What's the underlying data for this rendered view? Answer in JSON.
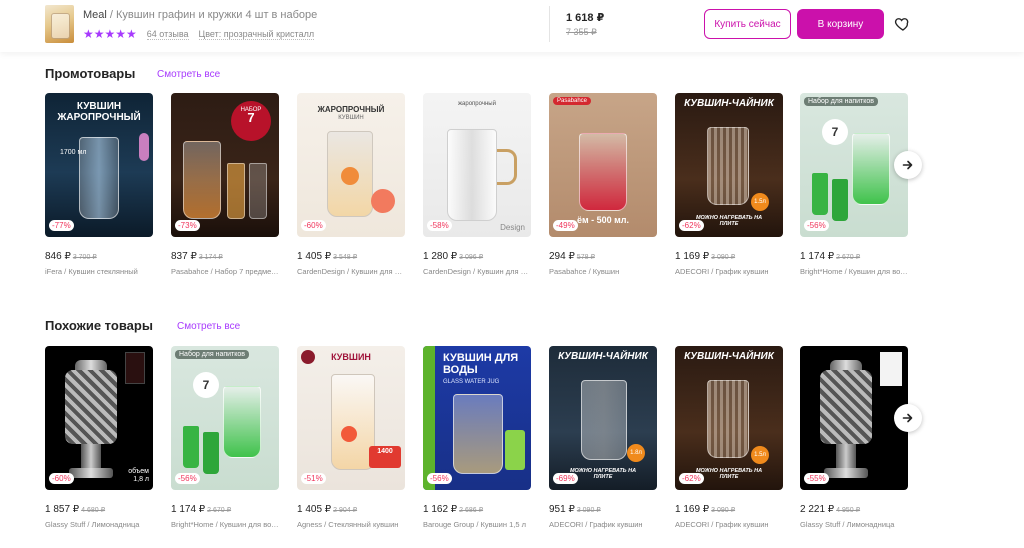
{
  "header": {
    "brand": "Meal",
    "separator": " / ",
    "product_title": "Кувшин графин и кружки 4 шт в наборе",
    "stars": "★★★★★",
    "reviews": "64 отзыва",
    "color": "Цвет: прозрачный кристалл",
    "price_now": "1 618 ₽",
    "price_old": "7 355 ₽",
    "buy_now_label": "Купить сейчас",
    "add_to_cart_label": "В корзину",
    "accent_color": "#cb11ab"
  },
  "promo": {
    "title": "Промотовары",
    "see_all": "Смотреть все",
    "items": [
      {
        "badge": "-77%",
        "price": "846 ₽",
        "old": "3 700 ₽",
        "desc": "iFera / Кувшин стеклянный",
        "img_text": "КУВШИН ЖАРОПРОЧНЫЙ",
        "img_sub": "1700 мл"
      },
      {
        "badge": "-73%",
        "price": "837 ₽",
        "old": "3 174 ₽",
        "desc": "Pasabahce / Набор 7 предметов",
        "img_text": "НАБОР",
        "img_sub": "7 ПРЕДМЕТОВ"
      },
      {
        "badge": "-60%",
        "price": "1 405 ₽",
        "old": "3 548 ₽",
        "desc": "CardenDesign / Кувшин для воды",
        "img_text": "ЖАРОПРОЧНЫЙ",
        "img_sub": "КУВШИН"
      },
      {
        "badge": "-58%",
        "price": "1 280 ₽",
        "old": "3 096 ₽",
        "desc": "CardenDesign / Кувшин для воды",
        "img_text": "жаропрочный",
        "img_sub": "Design"
      },
      {
        "badge": "-49%",
        "price": "294 ₽",
        "old": "578 ₽",
        "desc": "Pasabahce / Кувшин",
        "img_text": "Pasabahce",
        "img_sub": "ём - 500 мл."
      },
      {
        "badge": "-62%",
        "price": "1 169 ₽",
        "old": "3 090 ₽",
        "desc": "ADECORI / График кувшин",
        "img_text": "КУВШИН-ЧАЙНИК",
        "img_sub": "МОЖНО НАГРЕВАТЬ НА ПЛИТЕ"
      },
      {
        "badge": "-56%",
        "price": "1 174 ₽",
        "old": "2 670 ₽",
        "desc": "Bright*Home / Кувшин для воды",
        "img_text": "Набор для напитков",
        "img_sub": "7"
      }
    ]
  },
  "similar": {
    "title": "Похожие товары",
    "see_all": "Смотреть все",
    "items": [
      {
        "badge": "-60%",
        "price": "1 857 ₽",
        "old": "4 680 ₽",
        "desc": "Glassy Stuff / Лимонадница",
        "img_text": "",
        "img_sub": "объем 1,8 л"
      },
      {
        "badge": "-56%",
        "price": "1 174 ₽",
        "old": "2 670 ₽",
        "desc": "Bright*Home / Кувшин для воды",
        "img_text": "Набор для напитков",
        "img_sub": "7"
      },
      {
        "badge": "-51%",
        "price": "1 405 ₽",
        "old": "2 904 ₽",
        "desc": "Agness / Стеклянный кувшин",
        "img_text": "КУВШИН",
        "img_sub": "1400"
      },
      {
        "badge": "-56%",
        "price": "1 162 ₽",
        "old": "2 686 ₽",
        "desc": "Barouge Group / Кувшин 1,5 л",
        "img_text": "КУВШИН ДЛЯ ВОДЫ",
        "img_sub": "GLASS WATER JUG"
      },
      {
        "badge": "-69%",
        "price": "951 ₽",
        "old": "3 090 ₽",
        "desc": "ADECORI / График кувшин",
        "img_text": "КУВШИН-ЧАЙНИК",
        "img_sub": "МОЖНО НАГРЕВАТЬ НА ПЛИТЕ"
      },
      {
        "badge": "-62%",
        "price": "1 169 ₽",
        "old": "3 090 ₽",
        "desc": "ADECORI / График кувшин",
        "img_text": "КУВШИН-ЧАЙНИК",
        "img_sub": "МОЖНО НАГРЕВАТЬ НА ПЛИТЕ"
      },
      {
        "badge": "-55%",
        "price": "2 221 ₽",
        "old": "4 950 ₽",
        "desc": "Glassy Stuff / Лимонадница",
        "img_text": "",
        "img_sub": ""
      }
    ]
  },
  "icons": {
    "heart": "heart-icon",
    "next": "arrow-right-icon"
  }
}
